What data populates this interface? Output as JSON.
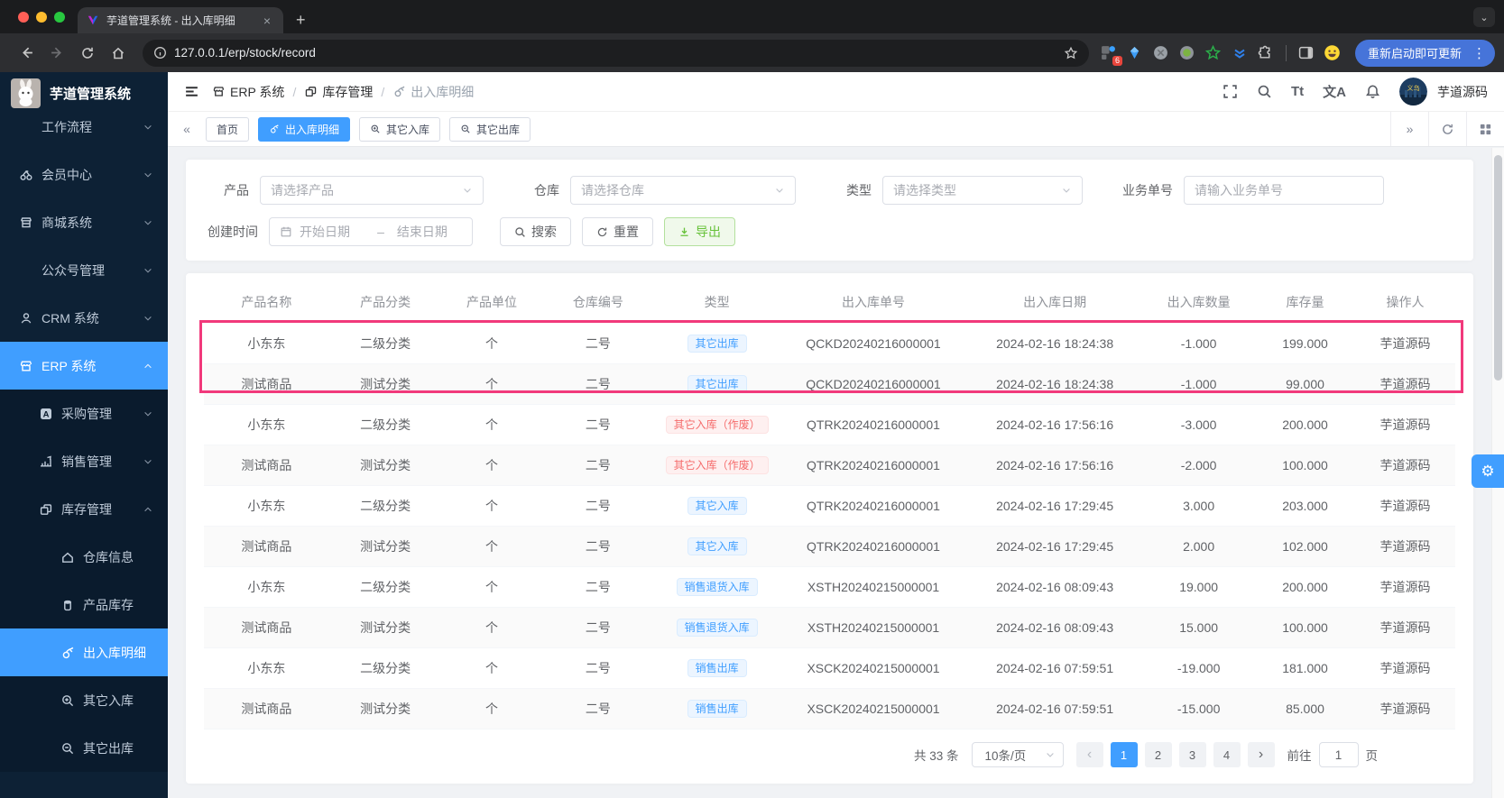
{
  "browser": {
    "tab_title": "芋道管理系统 - 出入库明细",
    "url": "127.0.0.1/erp/stock/record",
    "extension_badge": "6",
    "update_button": "重新启动即可更新"
  },
  "sidebar": {
    "logo_title": "芋道管理系统",
    "menu": [
      {
        "label": "工作流程",
        "icon": "none",
        "level": 1,
        "chevron": "down"
      },
      {
        "label": "会员中心",
        "icon": "member",
        "level": 1,
        "chevron": "down"
      },
      {
        "label": "商城系统",
        "icon": "mall",
        "level": 1,
        "chevron": "down"
      },
      {
        "label": "公众号管理",
        "icon": "none",
        "level": 1,
        "chevron": "down"
      },
      {
        "label": "CRM 系统",
        "icon": "user",
        "level": 1,
        "chevron": "down"
      },
      {
        "label": "ERP 系统",
        "icon": "shop",
        "level": 1,
        "chevron": "up",
        "active": true
      },
      {
        "label": "采购管理",
        "icon": "purchase",
        "level": 2,
        "chevron": "down"
      },
      {
        "label": "销售管理",
        "icon": "sales",
        "level": 2,
        "chevron": "down"
      },
      {
        "label": "库存管理",
        "icon": "inventory",
        "level": 2,
        "chevron": "up"
      },
      {
        "label": "仓库信息",
        "icon": "house",
        "level": 3
      },
      {
        "label": "产品库存",
        "icon": "cup",
        "level": 3
      },
      {
        "label": "出入库明细",
        "icon": "record",
        "level": 3,
        "active": true
      },
      {
        "label": "其它入库",
        "icon": "zoom-in",
        "level": 3
      },
      {
        "label": "其它出库",
        "icon": "zoom-out",
        "level": 3
      }
    ]
  },
  "topbar": {
    "breadcrumb": [
      {
        "label": "ERP 系统",
        "icon": "shop",
        "muted": false
      },
      {
        "label": "库存管理",
        "icon": "inventory",
        "muted": false
      },
      {
        "label": "出入库明细",
        "icon": "record",
        "muted": true
      }
    ],
    "font_tool": "Tt",
    "lang_tool": "文A",
    "username": "芋道源码"
  },
  "tags": [
    {
      "label": "首页",
      "icon": null,
      "active": false
    },
    {
      "label": "出入库明细",
      "icon": "record",
      "active": true
    },
    {
      "label": "其它入库",
      "icon": "zoom-in",
      "active": false
    },
    {
      "label": "其它出库",
      "icon": "zoom-out",
      "active": false
    }
  ],
  "filters": {
    "product_label": "产品",
    "product_placeholder": "请选择产品",
    "warehouse_label": "仓库",
    "warehouse_placeholder": "请选择仓库",
    "type_label": "类型",
    "type_placeholder": "请选择类型",
    "bizno_label": "业务单号",
    "bizno_placeholder": "请输入业务单号",
    "created_label": "创建时间",
    "date_start_placeholder": "开始日期",
    "date_separator": "–",
    "date_end_placeholder": "结束日期",
    "search_button": "搜索",
    "reset_button": "重置",
    "export_button": "导出"
  },
  "table": {
    "columns": [
      "产品名称",
      "产品分类",
      "产品单位",
      "仓库编号",
      "类型",
      "出入库单号",
      "出入库日期",
      "出入库数量",
      "库存量",
      "操作人"
    ],
    "highlight_color": "#F1397B",
    "rows": [
      {
        "product": "小东东",
        "category": "二级分类",
        "unit": "个",
        "warehouse": "二号",
        "type": "其它出库",
        "type_color": "blue",
        "order_no": "QCKD20240216000001",
        "date": "2024-02-16 18:24:38",
        "quantity": "-1.000",
        "stock": "199.000",
        "operator": "芋道源码"
      },
      {
        "product": "测试商品",
        "category": "测试分类",
        "unit": "个",
        "warehouse": "二号",
        "type": "其它出库",
        "type_color": "blue",
        "order_no": "QCKD20240216000001",
        "date": "2024-02-16 18:24:38",
        "quantity": "-1.000",
        "stock": "99.000",
        "operator": "芋道源码"
      },
      {
        "product": "小东东",
        "category": "二级分类",
        "unit": "个",
        "warehouse": "二号",
        "type": "其它入库（作废）",
        "type_color": "red",
        "order_no": "QTRK20240216000001",
        "date": "2024-02-16 17:56:16",
        "quantity": "-3.000",
        "stock": "200.000",
        "operator": "芋道源码"
      },
      {
        "product": "测试商品",
        "category": "测试分类",
        "unit": "个",
        "warehouse": "二号",
        "type": "其它入库（作废）",
        "type_color": "red",
        "order_no": "QTRK20240216000001",
        "date": "2024-02-16 17:56:16",
        "quantity": "-2.000",
        "stock": "100.000",
        "operator": "芋道源码"
      },
      {
        "product": "小东东",
        "category": "二级分类",
        "unit": "个",
        "warehouse": "二号",
        "type": "其它入库",
        "type_color": "blue",
        "order_no": "QTRK20240216000001",
        "date": "2024-02-16 17:29:45",
        "quantity": "3.000",
        "stock": "203.000",
        "operator": "芋道源码"
      },
      {
        "product": "测试商品",
        "category": "测试分类",
        "unit": "个",
        "warehouse": "二号",
        "type": "其它入库",
        "type_color": "blue",
        "order_no": "QTRK20240216000001",
        "date": "2024-02-16 17:29:45",
        "quantity": "2.000",
        "stock": "102.000",
        "operator": "芋道源码"
      },
      {
        "product": "小东东",
        "category": "二级分类",
        "unit": "个",
        "warehouse": "二号",
        "type": "销售退货入库",
        "type_color": "blue",
        "order_no": "XSTH20240215000001",
        "date": "2024-02-16 08:09:43",
        "quantity": "19.000",
        "stock": "200.000",
        "operator": "芋道源码"
      },
      {
        "product": "测试商品",
        "category": "测试分类",
        "unit": "个",
        "warehouse": "二号",
        "type": "销售退货入库",
        "type_color": "blue",
        "order_no": "XSTH20240215000001",
        "date": "2024-02-16 08:09:43",
        "quantity": "15.000",
        "stock": "100.000",
        "operator": "芋道源码"
      },
      {
        "product": "小东东",
        "category": "二级分类",
        "unit": "个",
        "warehouse": "二号",
        "type": "销售出库",
        "type_color": "blue",
        "order_no": "XSCK20240215000001",
        "date": "2024-02-16 07:59:51",
        "quantity": "-19.000",
        "stock": "181.000",
        "operator": "芋道源码"
      },
      {
        "product": "测试商品",
        "category": "测试分类",
        "unit": "个",
        "warehouse": "二号",
        "type": "销售出库",
        "type_color": "blue",
        "order_no": "XSCK20240215000001",
        "date": "2024-02-16 07:59:51",
        "quantity": "-15.000",
        "stock": "85.000",
        "operator": "芋道源码"
      }
    ]
  },
  "pagination": {
    "total_text": "共 33 条",
    "page_size": "10条/页",
    "pages": [
      "1",
      "2",
      "3",
      "4"
    ],
    "active_page": "1",
    "goto_label": "前往",
    "goto_value": "1",
    "page_unit": "页"
  },
  "colors": {
    "accent": "#409eff",
    "highlight": "#F1397B"
  }
}
